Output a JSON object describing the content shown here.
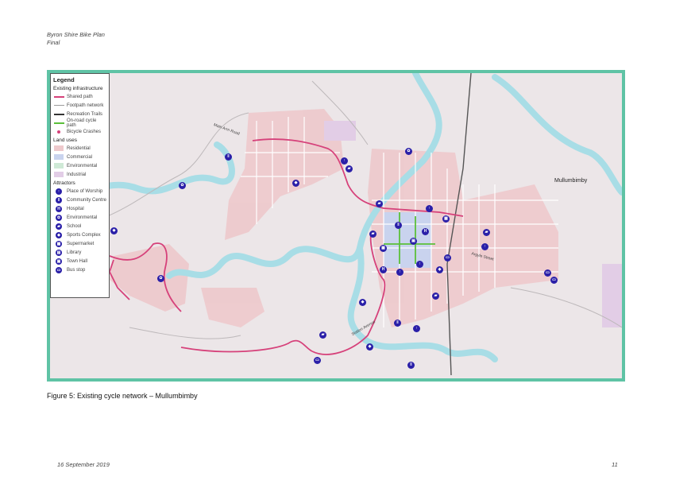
{
  "header": {
    "line1": "Byron Shire Bike Plan",
    "line2": "Final"
  },
  "legend": {
    "title": "Legend",
    "sections": {
      "infrastructure": "Existing infrastructure",
      "land_uses": "Land uses",
      "attractors": "Attractors"
    },
    "infrastructure": [
      {
        "label": "Shared path",
        "color": "#d6417a"
      },
      {
        "label": "Footpath network",
        "color": "#9a9a9a"
      },
      {
        "label": "Recreation Trails",
        "color": "#333333"
      },
      {
        "label": "On-road cycle path",
        "color": "#5bbf3a"
      },
      {
        "label": "Bicycle Crashes",
        "color": "#d6417a"
      }
    ],
    "land_uses": [
      {
        "label": "Residential",
        "color": "#eec9cc"
      },
      {
        "label": "Commercial",
        "color": "#c9d3ee"
      },
      {
        "label": "Environmental",
        "color": "#cfe9d6"
      },
      {
        "label": "Industrial",
        "color": "#e2cde6"
      }
    ],
    "attractors": [
      {
        "label": "Place of Worship",
        "glyph": "↑"
      },
      {
        "label": "Community Centre",
        "glyph": "‖"
      },
      {
        "label": "Hospital",
        "glyph": "H"
      },
      {
        "label": "Environmental",
        "glyph": "✿"
      },
      {
        "label": "School",
        "glyph": "▰"
      },
      {
        "label": "Sports Complex",
        "glyph": "◆"
      },
      {
        "label": "Supermarket",
        "glyph": "▦"
      },
      {
        "label": "Library",
        "glyph": "▤"
      },
      {
        "label": "Town Hall",
        "glyph": "▣"
      },
      {
        "label": "Bus stop",
        "glyph": "▭"
      }
    ]
  },
  "map": {
    "town_label": "Mullumbimby",
    "streets": {
      "main_arm": "Main Arm Road",
      "argyle": "Argyle Street",
      "station": "Station Avenue"
    },
    "colors": {
      "water": "#a8dde6",
      "residential": "#eec9cc",
      "frame": "#5fc3a5",
      "shared_path": "#d6417a",
      "attractor": "#2a1fa8"
    }
  },
  "caption": "Figure 5: Existing cycle network – Mullumbimby",
  "footer": {
    "date": "16 September 2019",
    "page": "11"
  }
}
